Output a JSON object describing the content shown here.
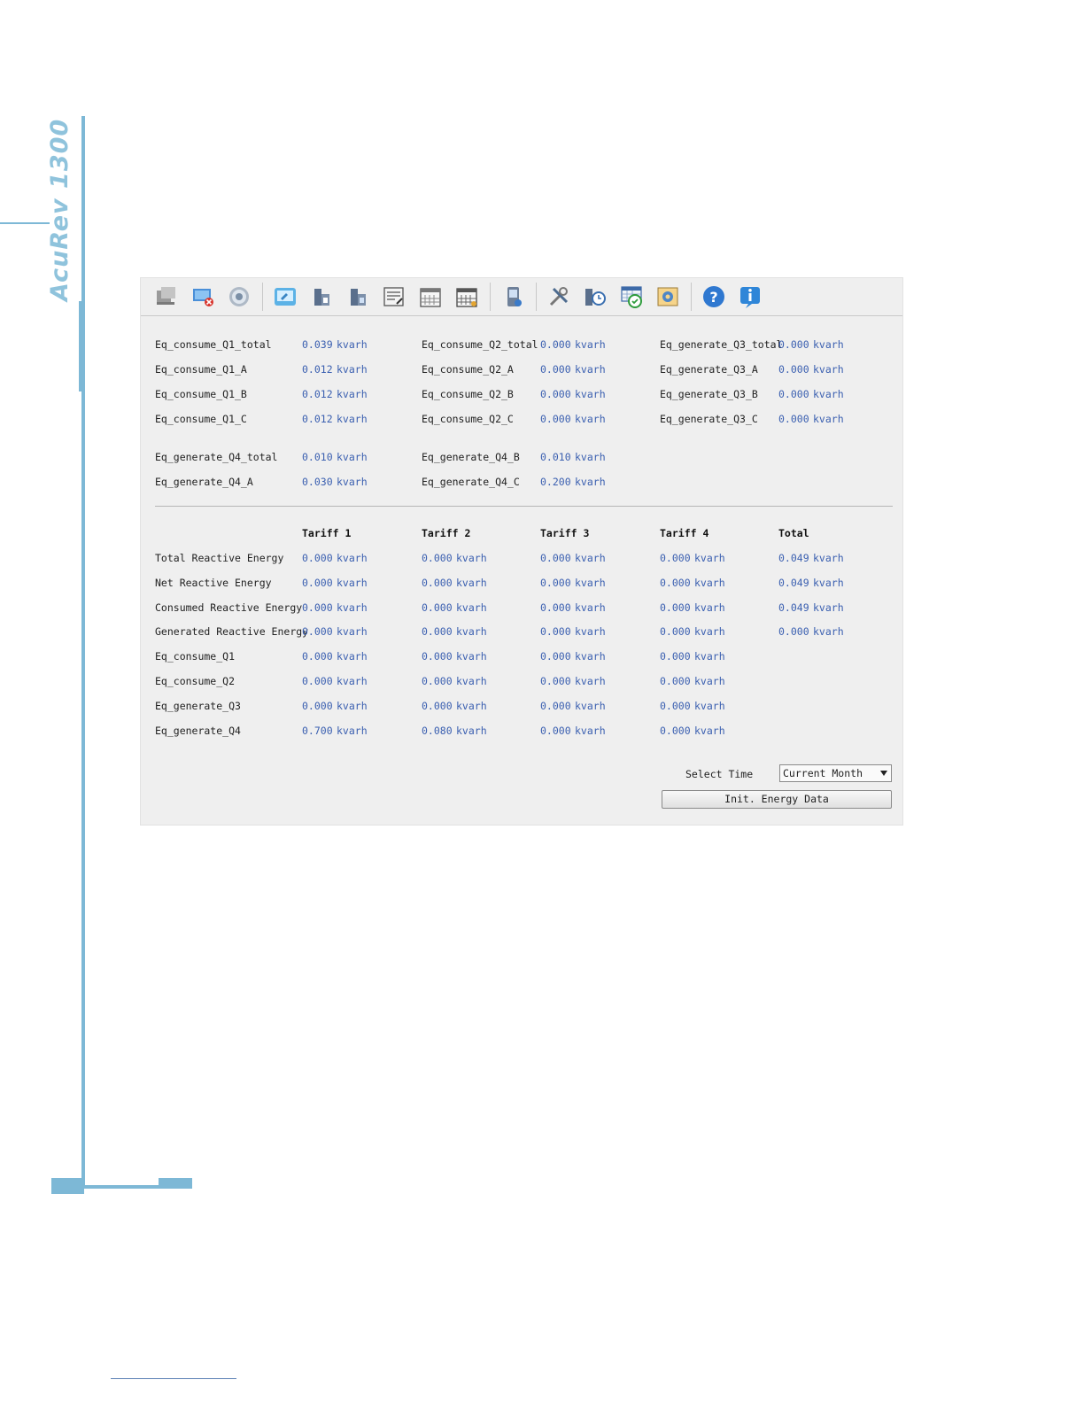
{
  "brand": {
    "text": "AcuRev 1300"
  },
  "toolbar": {
    "buttons": [
      {
        "icon": "windows-icon"
      },
      {
        "icon": "disconnect-icon"
      },
      {
        "icon": "settings-gear-icon"
      },
      {
        "icon": "monitor-icon"
      },
      {
        "icon": "meter-1-icon"
      },
      {
        "icon": "meter-2-icon"
      },
      {
        "icon": "form-edit-icon"
      },
      {
        "icon": "calendar-icon"
      },
      {
        "icon": "calendar-alt-icon"
      },
      {
        "icon": "device-icon"
      },
      {
        "icon": "tools-icon"
      },
      {
        "icon": "clock-meter-icon"
      },
      {
        "icon": "schedule-icon"
      },
      {
        "icon": "screen-config-icon"
      },
      {
        "icon": "help-icon"
      },
      {
        "icon": "info-icon"
      }
    ]
  },
  "quadrant": {
    "col1": [
      {
        "label": "Eq_consume_Q1_total",
        "value": "0.039",
        "unit": "kvarh"
      },
      {
        "label": "Eq_consume_Q1_A",
        "value": "0.012",
        "unit": "kvarh"
      },
      {
        "label": "Eq_consume_Q1_B",
        "value": "0.012",
        "unit": "kvarh"
      },
      {
        "label": "Eq_consume_Q1_C",
        "value": "0.012",
        "unit": "kvarh"
      }
    ],
    "col2": [
      {
        "label": "Eq_consume_Q2_total",
        "value": "0.000",
        "unit": "kvarh"
      },
      {
        "label": "Eq_consume_Q2_A",
        "value": "0.000",
        "unit": "kvarh"
      },
      {
        "label": "Eq_consume_Q2_B",
        "value": "0.000",
        "unit": "kvarh"
      },
      {
        "label": "Eq_consume_Q2_C",
        "value": "0.000",
        "unit": "kvarh"
      }
    ],
    "col3": [
      {
        "label": "Eq_generate_Q3_total",
        "value": "0.000",
        "unit": "kvarh"
      },
      {
        "label": "Eq_generate_Q3_A",
        "value": "0.000",
        "unit": "kvarh"
      },
      {
        "label": "Eq_generate_Q3_B",
        "value": "0.000",
        "unit": "kvarh"
      },
      {
        "label": "Eq_generate_Q3_C",
        "value": "0.000",
        "unit": "kvarh"
      }
    ],
    "q4_left": [
      {
        "label": "Eq_generate_Q4_total",
        "value": "0.010",
        "unit": "kvarh"
      },
      {
        "label": "Eq_generate_Q4_A",
        "value": "0.030",
        "unit": "kvarh"
      }
    ],
    "q4_right": [
      {
        "label": "Eq_generate_Q4_B",
        "value": "0.010",
        "unit": "kvarh"
      },
      {
        "label": "Eq_generate_Q4_C",
        "value": "0.200",
        "unit": "kvarh"
      }
    ]
  },
  "tariff_table": {
    "headers": [
      "Tariff 1",
      "Tariff 2",
      "Tariff 3",
      "Tariff 4",
      "Total"
    ],
    "unit": "kvarh",
    "rows": [
      {
        "label": "Total Reactive Energy",
        "values": [
          "0.000",
          "0.000",
          "0.000",
          "0.000",
          "0.049"
        ]
      },
      {
        "label": "Net Reactive Energy",
        "values": [
          "0.000",
          "0.000",
          "0.000",
          "0.000",
          "0.049"
        ]
      },
      {
        "label": "Consumed Reactive Energy",
        "values": [
          "0.000",
          "0.000",
          "0.000",
          "0.000",
          "0.049"
        ]
      },
      {
        "label": "Generated Reactive Energy",
        "values": [
          "0.000",
          "0.000",
          "0.000",
          "0.000",
          "0.000"
        ]
      },
      {
        "label": "Eq_consume_Q1",
        "values": [
          "0.000",
          "0.000",
          "0.000",
          "0.000"
        ]
      },
      {
        "label": "Eq_consume_Q2",
        "values": [
          "0.000",
          "0.000",
          "0.000",
          "0.000"
        ]
      },
      {
        "label": "Eq_generate_Q3",
        "values": [
          "0.000",
          "0.000",
          "0.000",
          "0.000"
        ]
      },
      {
        "label": "Eq_generate_Q4",
        "values": [
          "0.700",
          "0.080",
          "0.000",
          "0.000"
        ]
      }
    ]
  },
  "controls": {
    "select_label": "Select Time",
    "select_value": "Current Month",
    "init_button": "Init. Energy Data"
  }
}
